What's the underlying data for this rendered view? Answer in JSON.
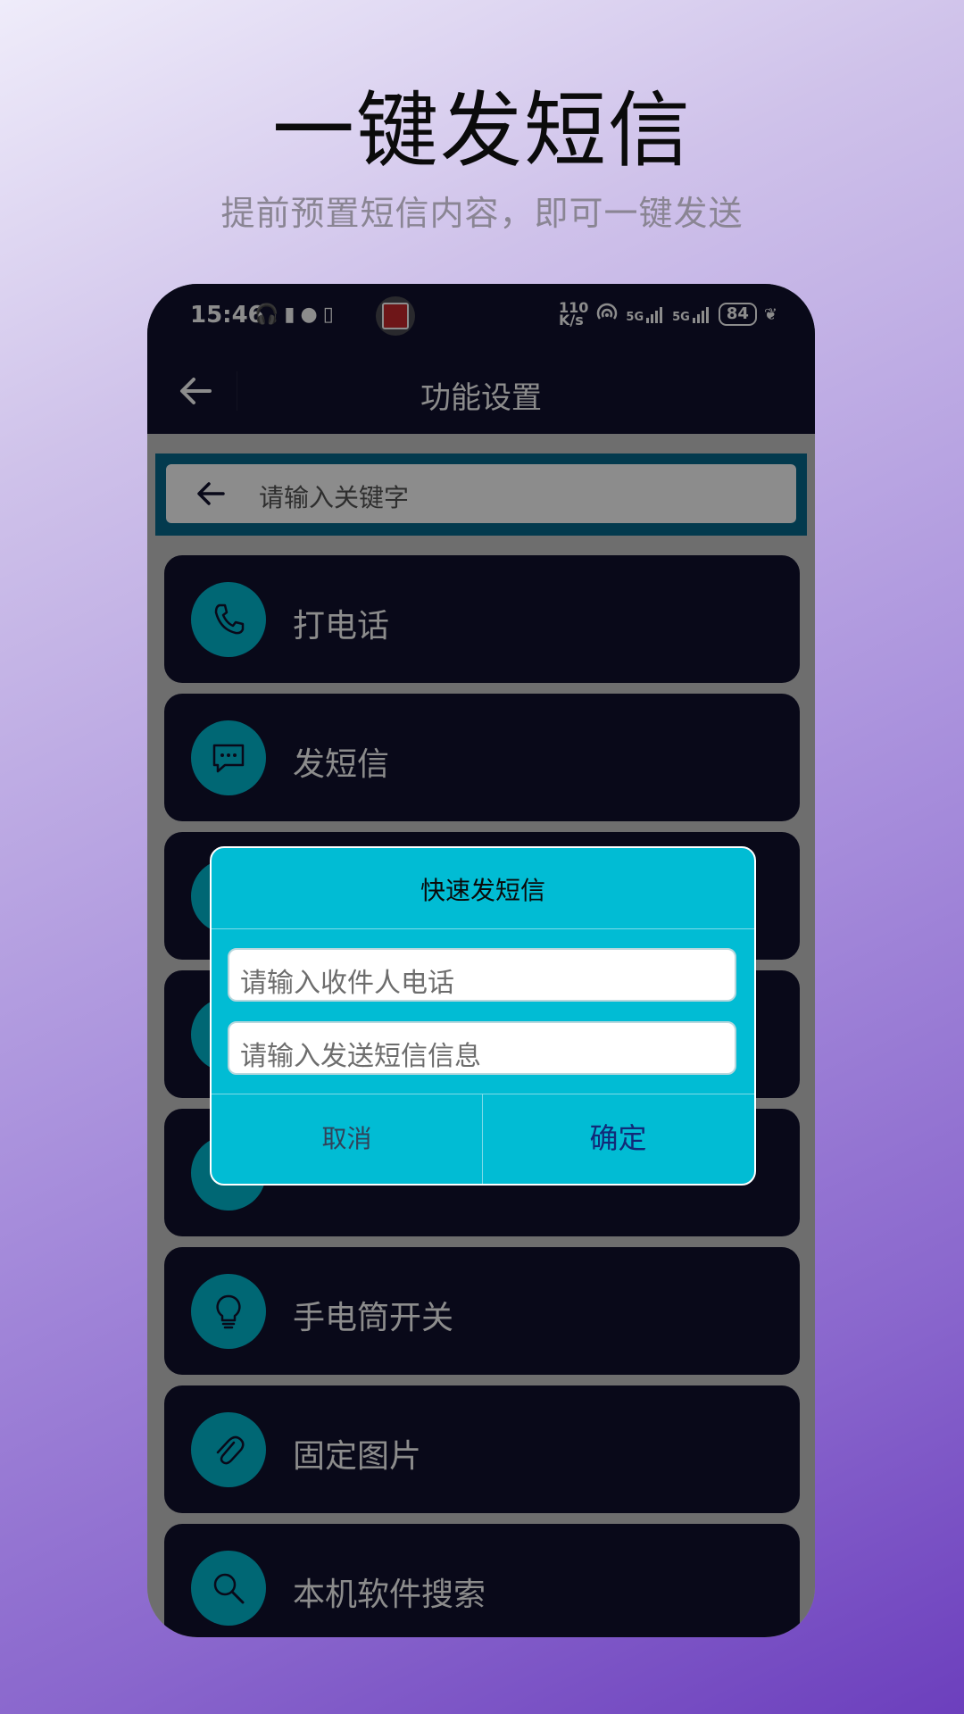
{
  "promo": {
    "title": "一键发短信",
    "subtitle": "提前预置短信内容，即可一键发送"
  },
  "status_bar": {
    "time": "15:46",
    "net_speed_top": "110",
    "net_speed_bottom": "K/s",
    "signal_1_label": "5G",
    "signal_2_label": "5G",
    "battery": "84"
  },
  "app_bar": {
    "title": "功能设置"
  },
  "search": {
    "placeholder": "请输入关键字"
  },
  "list": {
    "items": [
      {
        "label": "打电话",
        "icon": "phone-icon"
      },
      {
        "label": "发短信",
        "icon": "message-icon"
      },
      {
        "label": "",
        "icon": "app-icon"
      },
      {
        "label": "",
        "icon": "app-icon"
      },
      {
        "label": "",
        "icon": "app-icon"
      },
      {
        "label": "手电筒开关",
        "icon": "lightbulb-icon"
      },
      {
        "label": "固定图片",
        "icon": "pin-image-icon"
      },
      {
        "label": "本机软件搜索",
        "icon": "search-icon"
      }
    ]
  },
  "dialog": {
    "title": "快速发短信",
    "phone_placeholder": "请输入收件人电话",
    "message_placeholder": "请输入发送短信信息",
    "cancel_label": "取消",
    "ok_label": "确定"
  },
  "colors": {
    "dark_navy": "#12122e",
    "cyan": "#01bcd4",
    "search_border": "#076a8e"
  }
}
